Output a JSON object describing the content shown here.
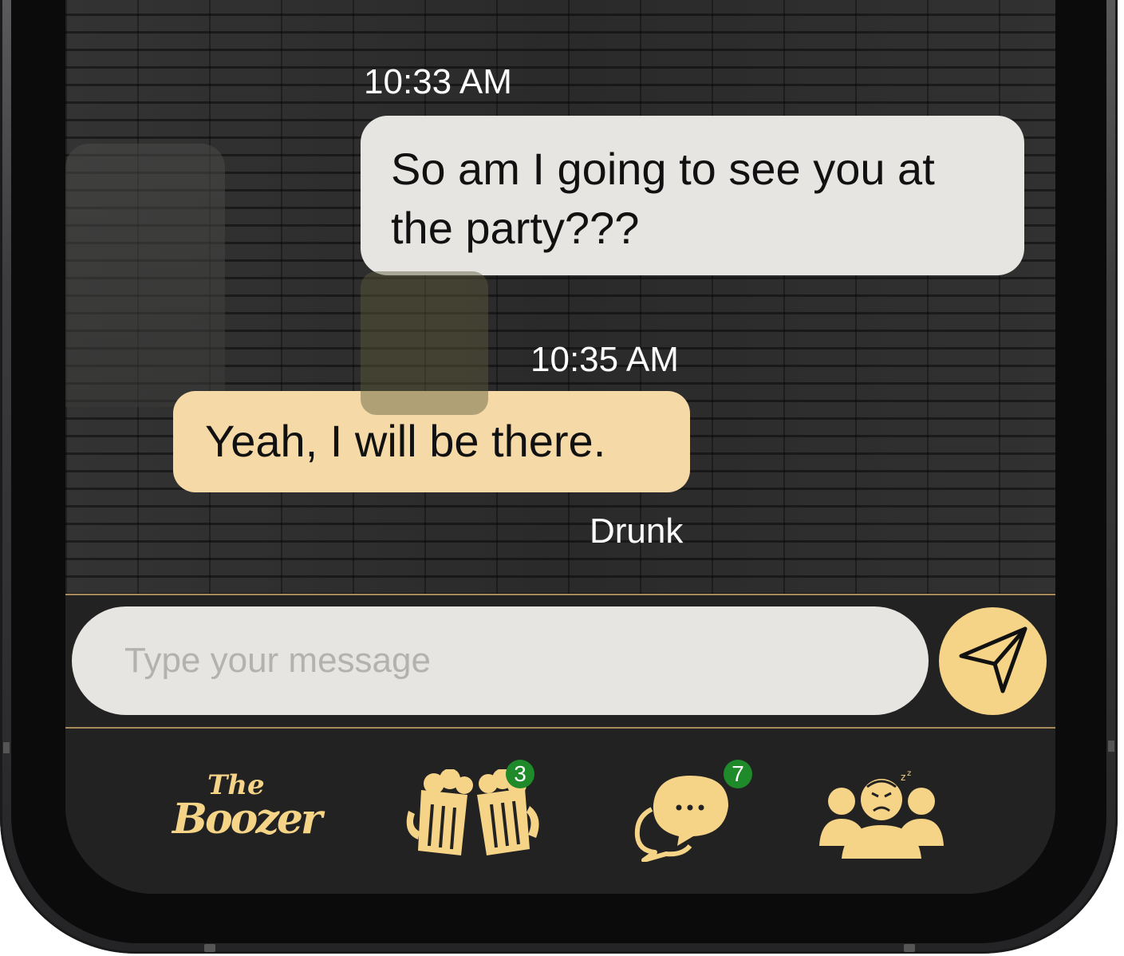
{
  "conversation": {
    "messages": [
      {
        "time": "10:33 AM",
        "text": "So am I going to see you at the party???",
        "direction": "sent"
      },
      {
        "time": "10:35 AM",
        "text": "Yeah, I will be there.",
        "direction": "received",
        "sender": "Drunk"
      }
    ]
  },
  "composer": {
    "placeholder": "Type your message",
    "value": "",
    "send_icon": "paper-plane-icon"
  },
  "tabbar": {
    "items": [
      {
        "name": "home",
        "icon": "the-boozer-logo",
        "logo_text_1": "The",
        "logo_text_2": "Boozer"
      },
      {
        "name": "cheers",
        "icon": "beer-mugs-icon",
        "badge": "3"
      },
      {
        "name": "messages",
        "icon": "chat-bubbles-icon",
        "badge": "7"
      },
      {
        "name": "friends",
        "icon": "people-group-icon"
      }
    ]
  },
  "colors": {
    "accent": "#f5d387",
    "received_bubble": "#f5d9a7",
    "sent_bubble": "#e6e5e1",
    "badge": "#1f8a2a",
    "bar_background": "#222222"
  }
}
